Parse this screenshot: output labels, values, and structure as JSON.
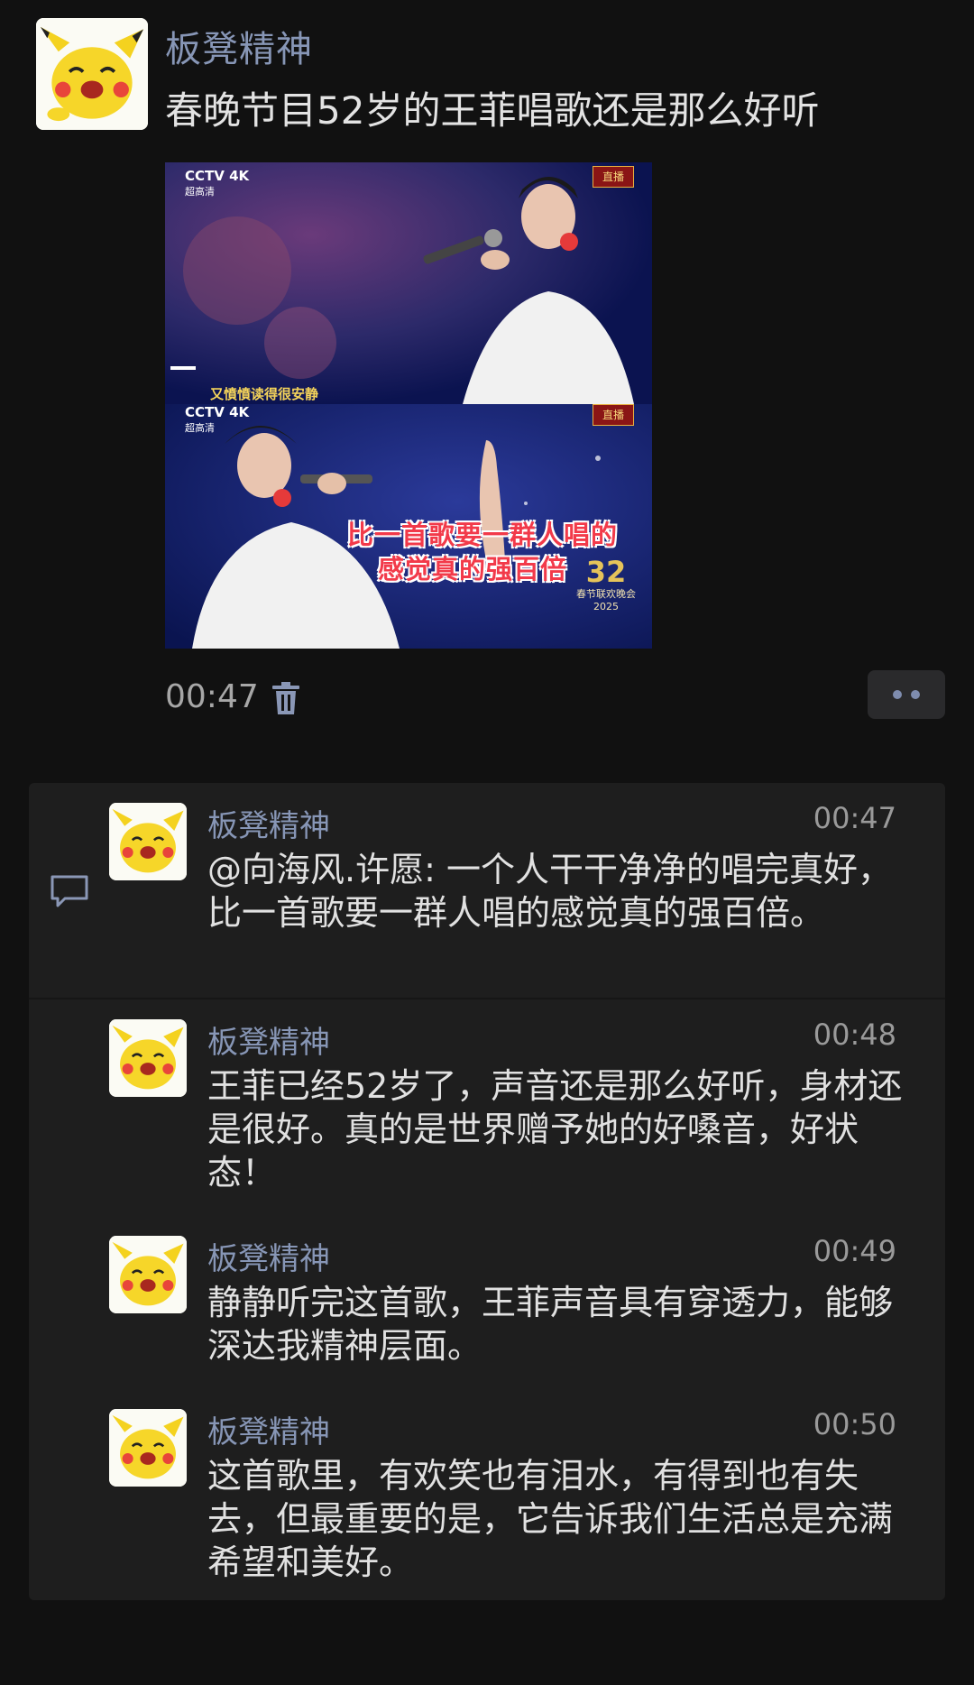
{
  "post": {
    "author": "板凳精神",
    "text": "春晚节目52岁的王菲唱歌还是那么好听",
    "time": "00:47",
    "image": {
      "top_logo": "CCTV 4K",
      "top_logo_sub": "超高清",
      "live_badge": "直播",
      "top_subtitle": "又憤憤读得很安静",
      "bottom_logo": "CCTV 4K",
      "bottom_logo_sub": "超高清",
      "caption_line1": "比一首歌要一群人唱的",
      "caption_line2": "感觉真的强百倍",
      "gala_text": "春节联欢晚会",
      "gala_year": "2025",
      "gala_number": "32"
    }
  },
  "comments": [
    {
      "author": "板凳精神",
      "time": "00:47",
      "text": "@向海风.许愿: 一个人干干净净的唱完真好，比一首歌要一群人唱的感觉真的强百倍。"
    },
    {
      "author": "板凳精神",
      "time": "00:48",
      "text": " 王菲已经52岁了，声音还是那么好听，身材还是很好。真的是世界赠予她的好嗓音，好状态！"
    },
    {
      "author": "板凳精神",
      "time": "00:49",
      "text": "静静听完这首歌，王菲声音具有穿透力，能够深达我精神层面。"
    },
    {
      "author": "板凳精神",
      "time": "00:50",
      "text": "这首歌里，有欢笑也有泪水，有得到也有失去，但最重要的是，它告诉我们生活总是充满希望和美好。"
    }
  ],
  "icons": {
    "avatar": "pikachu-avatar-icon",
    "delete": "trash-icon",
    "more": "more-dots-icon",
    "comment": "comment-bubble-icon"
  },
  "colors": {
    "background": "#111111",
    "panel": "#1e1e1e",
    "name_link": "#8796b6",
    "text": "#e1e1e1"
  }
}
